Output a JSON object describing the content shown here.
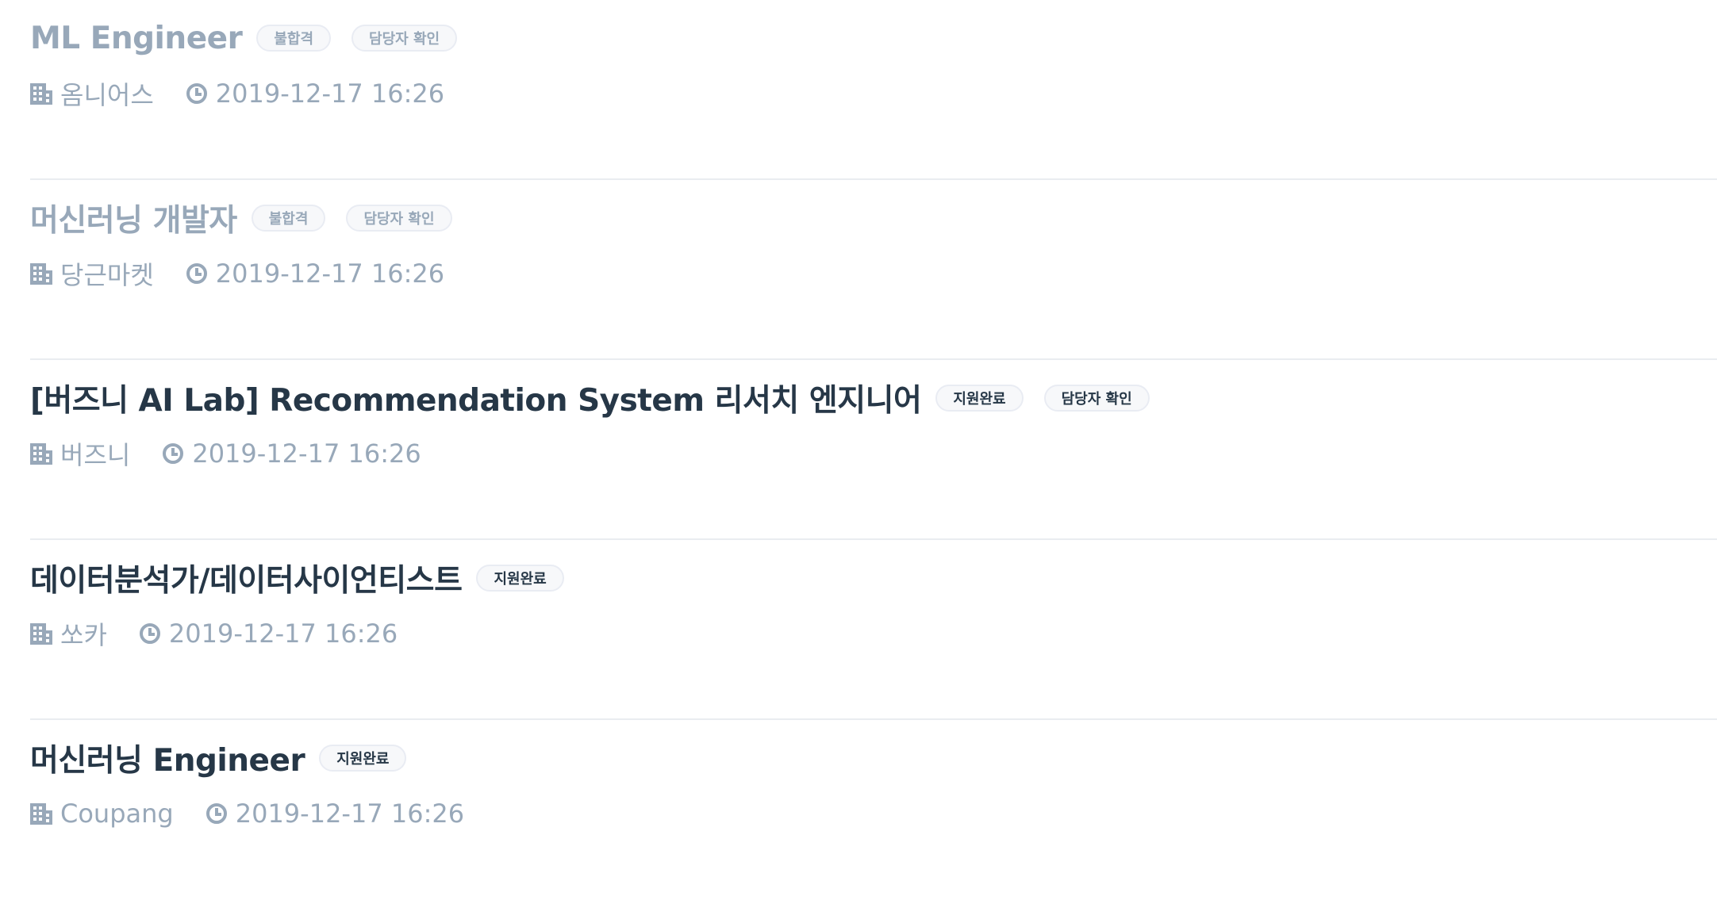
{
  "jobs": [
    {
      "title": "ML Engineer",
      "dimmed": true,
      "badges": [
        "불합격",
        "담당자 확인"
      ],
      "company": "옴니어스",
      "date": "2019-12-17 16:26",
      "company_icon": "building-icon",
      "date_icon": "clock-icon"
    },
    {
      "title": "머신러닝 개발자",
      "dimmed": true,
      "badges": [
        "불합격",
        "담당자 확인"
      ],
      "company": "당근마켓",
      "date": "2019-12-17 16:26",
      "company_icon": "building-icon",
      "date_icon": "clock-icon"
    },
    {
      "title": "[버즈니 AI Lab] Recommendation System 리서치 엔지니어",
      "dimmed": false,
      "badges": [
        "지원완료",
        "담당자 확인"
      ],
      "company": "버즈니",
      "date": "2019-12-17 16:26",
      "company_icon": "building-icon",
      "date_icon": "clock-icon"
    },
    {
      "title": "데이터분석가/데이터사이언티스트",
      "dimmed": false,
      "badges": [
        "지원완료"
      ],
      "company": "쏘카",
      "date": "2019-12-17 16:26",
      "company_icon": "building-icon",
      "date_icon": "clock-icon"
    },
    {
      "title": "머신러닝 Engineer",
      "dimmed": false,
      "badges": [
        "지원완료"
      ],
      "company": "Coupang",
      "date": "2019-12-17 16:26",
      "company_icon": "building-icon",
      "date_icon": "clock-icon"
    }
  ],
  "colors": {
    "title": "#263747",
    "muted": "#98a8b9",
    "divider": "#e9ecf0",
    "badge_bg": "#f7f8fa",
    "badge_border": "#e9ecf3"
  }
}
